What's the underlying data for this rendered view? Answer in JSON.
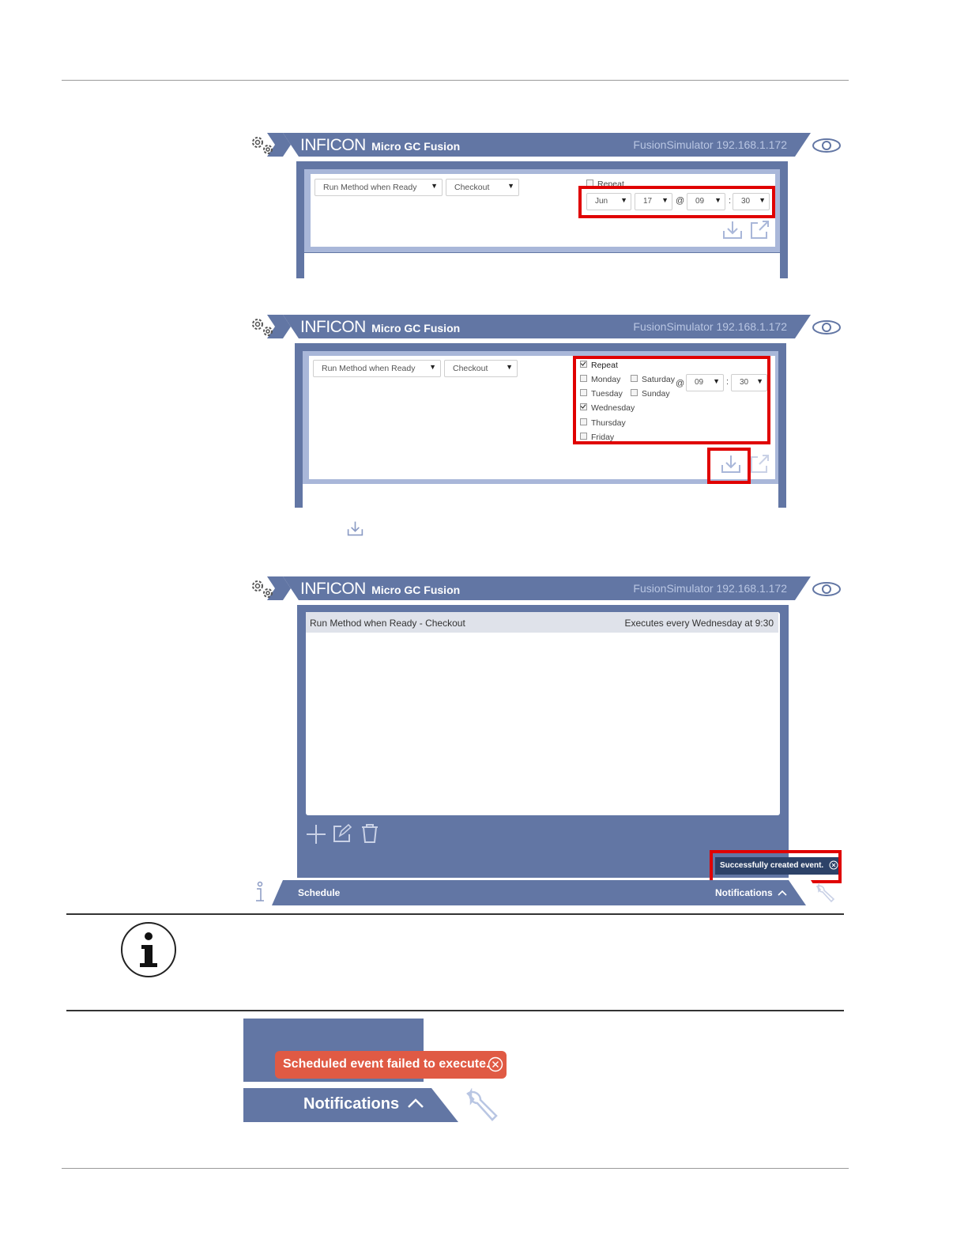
{
  "app": {
    "brand": "INFICON",
    "product": "Micro GC Fusion",
    "host": "FusionSimulator 192.168.1.172"
  },
  "screen1": {
    "method_select": "Run Method when Ready",
    "method_name_select": "Checkout",
    "repeat_label": "Repeat",
    "repeat_checked": false,
    "month": "Jun",
    "day": "17",
    "at": "@",
    "hour": "09",
    "colon": ":",
    "minute": "30"
  },
  "screen2": {
    "method_select": "Run Method when Ready",
    "method_name_select": "Checkout",
    "repeat_label": "Repeat",
    "repeat_checked": true,
    "days": [
      {
        "label": "Monday",
        "checked": false
      },
      {
        "label": "Tuesday",
        "checked": false
      },
      {
        "label": "Wednesday",
        "checked": true
      },
      {
        "label": "Thursday",
        "checked": false
      },
      {
        "label": "Friday",
        "checked": false
      },
      {
        "label": "Saturday",
        "checked": false
      },
      {
        "label": "Sunday",
        "checked": false
      }
    ],
    "at": "@",
    "hour": "09",
    "colon": ":",
    "minute": "30"
  },
  "screen3": {
    "event_name": "Run Method when Ready - Checkout",
    "event_schedule": "Executes every Wednesday at 9:30",
    "toast": "Successfully created event.",
    "schedule_label": "Schedule",
    "notifications_label": "Notifications"
  },
  "notification_zoom": {
    "fail_message": "Scheduled event failed to execute.",
    "notifications_label": "Notifications"
  },
  "colors": {
    "panel": "#6276a4",
    "highlight": "#e00000",
    "error": "#e05a44",
    "toast": "#2d4268"
  },
  "icons": [
    "gear-icon",
    "inficon-logo",
    "eye-icon",
    "download-icon",
    "open-external-icon",
    "plus-icon",
    "edit-icon",
    "trash-icon",
    "info-icon",
    "wrench-icon",
    "close-circle-icon",
    "chevron-up-icon"
  ]
}
